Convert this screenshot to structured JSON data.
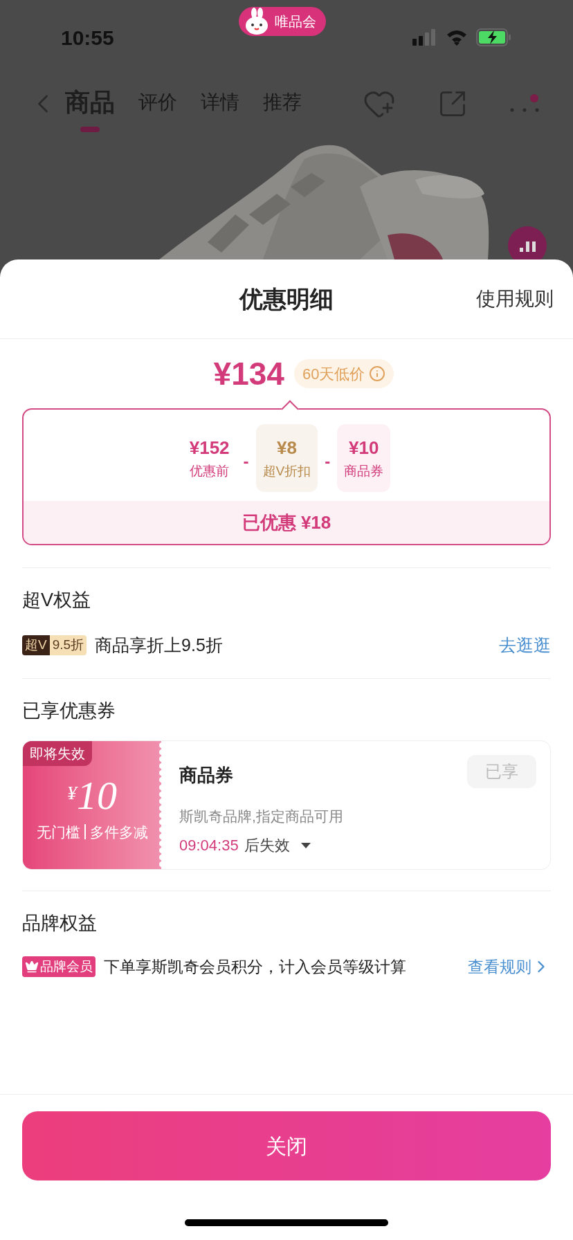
{
  "status_bar": {
    "time": "10:55",
    "app_badge": "唯品会"
  },
  "nav": {
    "tabs": [
      {
        "label": "商品",
        "selected": true
      },
      {
        "label": "评价",
        "selected": false
      },
      {
        "label": "详情",
        "selected": false
      },
      {
        "label": "推荐",
        "selected": false
      }
    ]
  },
  "sheet": {
    "title": "优惠明细",
    "rules_link": "使用规则",
    "price": "¥134",
    "price_badge": "60天低价",
    "breakdown": {
      "items": [
        {
          "kind": "price",
          "amount": "¥152",
          "label": "优惠前"
        },
        {
          "kind": "vip",
          "amount": "¥8",
          "label": "超V折扣"
        },
        {
          "kind": "coupon",
          "amount": "¥10",
          "label": "商品券"
        }
      ],
      "operators": [
        "-",
        "-"
      ],
      "saved": "已优惠 ¥18"
    },
    "super_v": {
      "title": "超V权益",
      "tag_left": "超V",
      "tag_right": "9.5折",
      "text": "商品享折上9.5折",
      "link": "去逛逛"
    },
    "coupons": {
      "title": "已享优惠券",
      "items": [
        {
          "status_tag": "即将失效",
          "currency": "¥",
          "amount": "10",
          "conditions": [
            "无门槛",
            "多件多减"
          ],
          "name": "商品券",
          "description": "斯凯奇品牌,指定商品可用",
          "countdown": "09:04:35",
          "expiry_suffix": "后失效",
          "button": "已享",
          "disabled": true
        }
      ]
    },
    "brand": {
      "title": "品牌权益",
      "tag": "品牌会员",
      "text": "下单享斯凯奇会员积分，计入会员等级计算",
      "link": "查看规则"
    },
    "close_button": "关闭"
  }
}
